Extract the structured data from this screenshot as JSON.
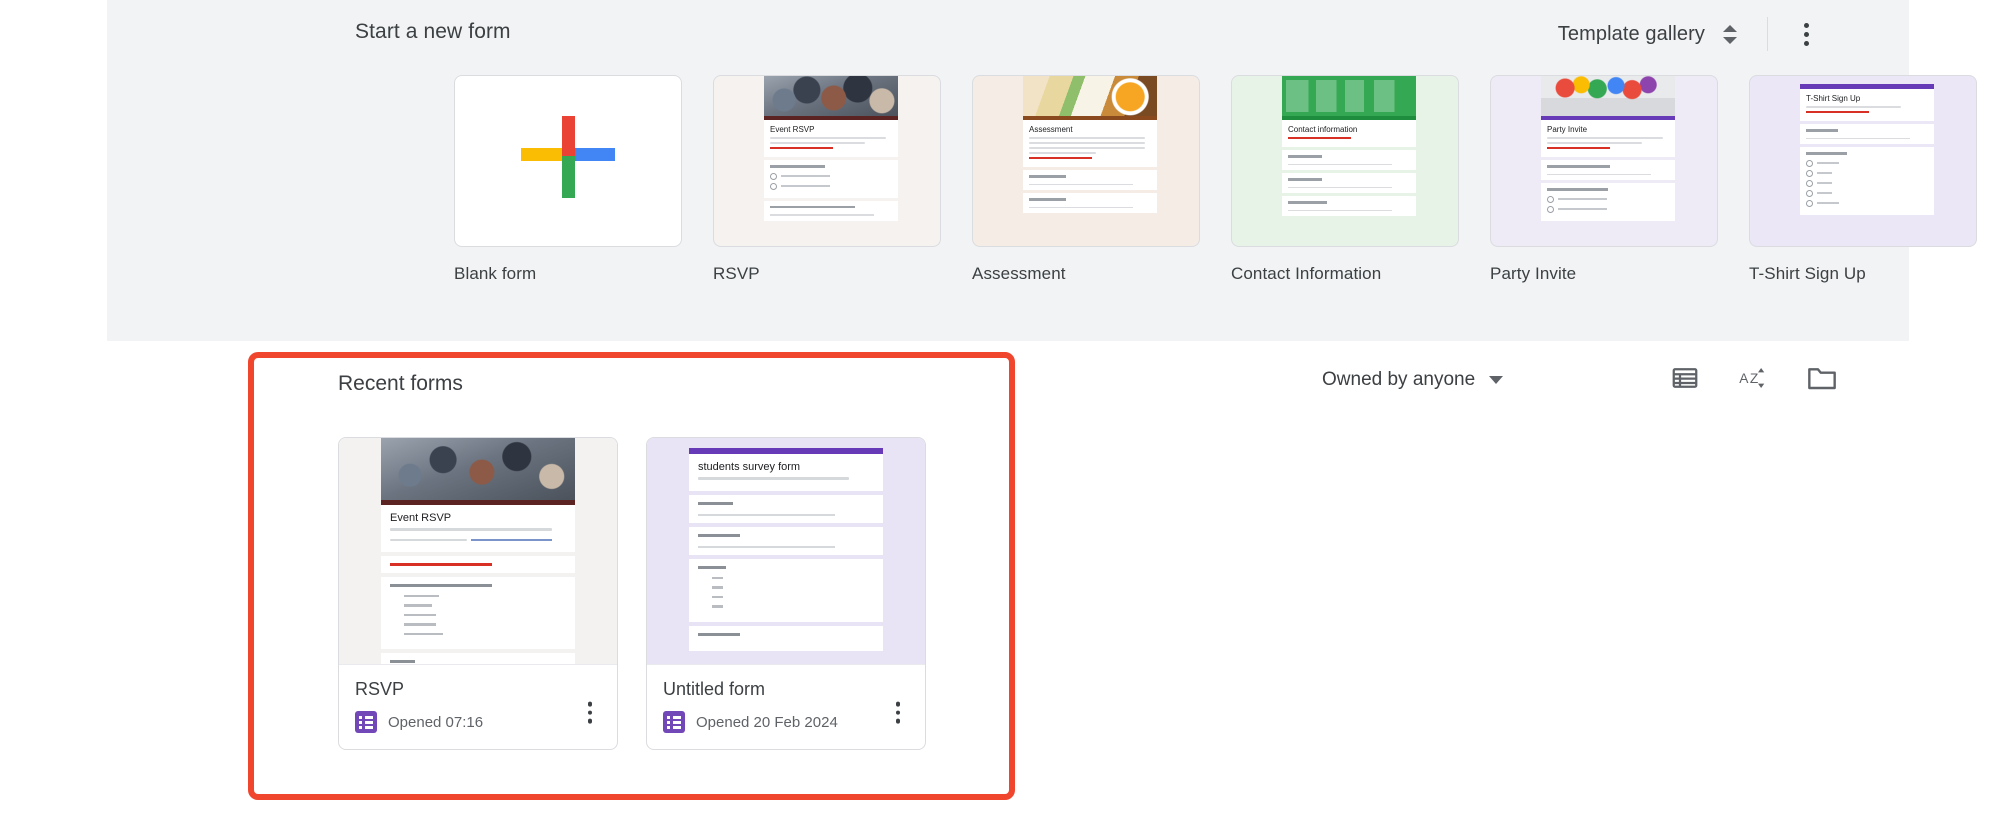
{
  "top_panel": {
    "heading": "Start a new form",
    "template_gallery_label": "Template gallery",
    "expand_icon": "expand-collapse-icon",
    "more_icon": "more-options-icon",
    "templates": [
      {
        "name": "Blank form",
        "icon": "plus-icon",
        "theme": "blank"
      },
      {
        "name": "RSVP",
        "preview_title": "Event RSVP",
        "theme": "rsvp"
      },
      {
        "name": "Assessment",
        "preview_title": "Assessment",
        "theme": "assessment"
      },
      {
        "name": "Contact Information",
        "preview_title": "Contact information",
        "theme": "contact"
      },
      {
        "name": "Party Invite",
        "preview_title": "Party Invite",
        "theme": "party"
      },
      {
        "name": "T-Shirt Sign Up",
        "preview_title": "T-Shirt Sign Up",
        "theme": "tshirt"
      }
    ]
  },
  "recent": {
    "heading": "Recent forms",
    "owner_filter": "Owned by anyone",
    "owner_caret_icon": "chevron-down-icon",
    "list_view_icon": "list-view-icon",
    "sort_icon": "sort-az-icon",
    "folder_icon": "folder-icon",
    "highlight_color": "#f0462d",
    "forms": [
      {
        "title": "RSVP",
        "opened": "Opened 07:16",
        "preview_title": "Event RSVP",
        "theme": "rsvp"
      },
      {
        "title": "Untitled form",
        "opened": "Opened 20 Feb 2024",
        "preview_title": "students survey form",
        "theme": "purple"
      }
    ]
  },
  "colors": {
    "panel_bg": "#f1f3f4",
    "page_bg": "#ffffff",
    "text": "#3c4043",
    "muted": "#5f6368",
    "forms_purple": "#7248b9",
    "google_red": "#ea4335",
    "google_yellow": "#fbbc04",
    "google_green": "#34a853",
    "google_blue": "#4285f4"
  }
}
